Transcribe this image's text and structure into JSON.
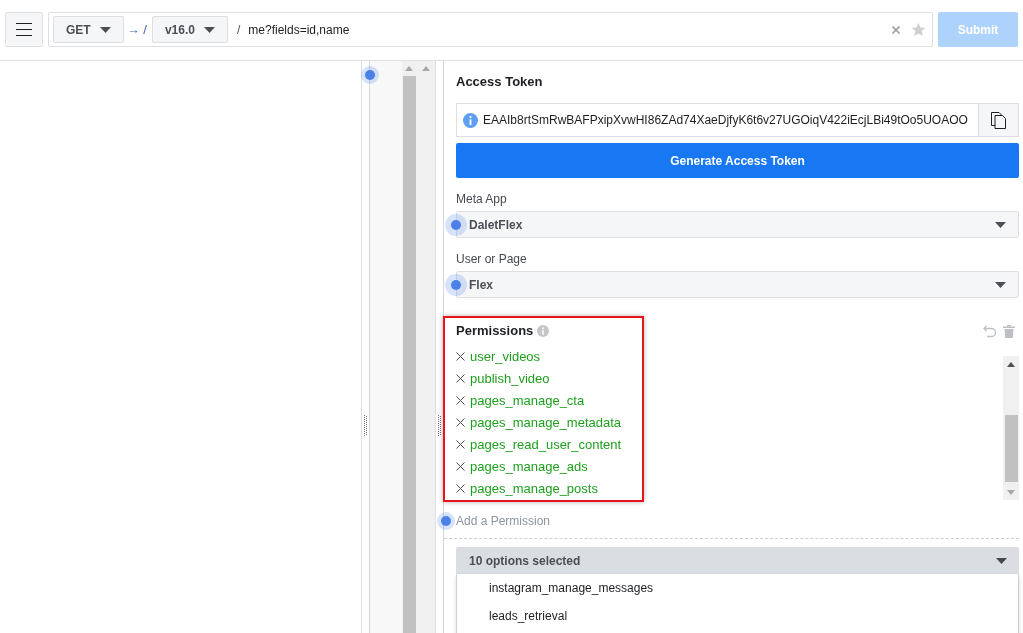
{
  "toolbar": {
    "method": "GET",
    "arrow": "→ /",
    "version": "v16.0",
    "separator": "/",
    "path": "me?fields=id,name",
    "submit": {
      "label": "Submit",
      "disabled": true
    }
  },
  "access_token": {
    "title": "Access Token",
    "value": "EAAIb8rtSmRwBAFPxipXvwHI86ZAd74XaeDjfyK6t6v27UGOiqV422iEcjLBi49tOo5UOAOO",
    "button": "Generate Access Token"
  },
  "selects": [
    {
      "label": "Meta App",
      "value": "DaletFlex"
    },
    {
      "label": "User or Page",
      "value": "Flex"
    }
  ],
  "permissions": {
    "title": "Permissions",
    "highlighted": true,
    "items": [
      "user_videos",
      "publish_video",
      "pages_manage_cta",
      "pages_manage_metadata",
      "pages_read_user_content",
      "pages_manage_ads",
      "pages_manage_posts"
    ],
    "add_placeholder": "Add a Permission",
    "dropdown": {
      "value": "10 options selected",
      "expanded": true,
      "options": [
        "instagram_manage_messages",
        "leads_retrieval"
      ]
    }
  }
}
